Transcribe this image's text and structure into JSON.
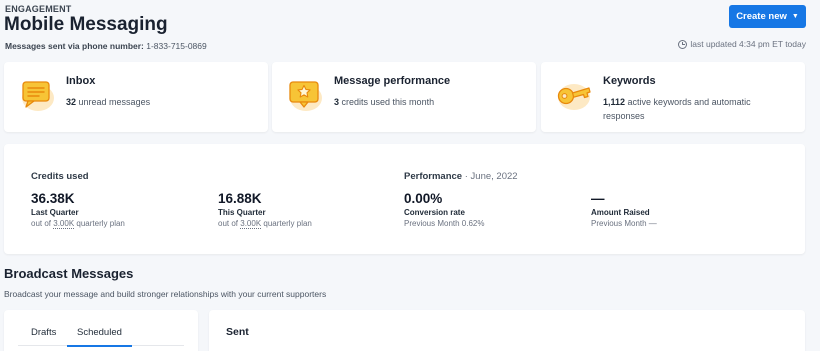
{
  "header": {
    "eyebrow": "ENGAGEMENT",
    "title": "Mobile Messaging",
    "phone_label": "Messages sent via phone number:",
    "phone_number": "1-833-715-0869",
    "create_label": "Create new",
    "updated_text": "last updated 4:34 pm ET today"
  },
  "cards": [
    {
      "title": "Inbox",
      "value": "32",
      "text": "unread messages",
      "icon": "chat-bubble-icon"
    },
    {
      "title": "Message performance",
      "value": "3",
      "text": "credits used this month",
      "icon": "star-message-icon"
    },
    {
      "title": "Keywords",
      "value": "1,112",
      "text": "active keywords and automatic responses",
      "icon": "key-icon"
    }
  ],
  "credits": {
    "heading": "Credits used",
    "items": [
      {
        "value": "36.38K",
        "label": "Last Quarter",
        "sub_pre": "out of",
        "sub_plan": "3.00K",
        "sub_post": "quarterly plan"
      },
      {
        "value": "16.88K",
        "label": "This Quarter",
        "sub_pre": "out of",
        "sub_plan": "3.00K",
        "sub_post": "quarterly plan"
      }
    ]
  },
  "performance": {
    "heading": "Performance",
    "period": "· June, 2022",
    "items": [
      {
        "value": "0.00%",
        "label": "Conversion rate",
        "sub": "Previous Month 0.62%"
      },
      {
        "value": "—",
        "label": "Amount Raised",
        "sub": "Previous Month —"
      }
    ]
  },
  "broadcast": {
    "title": "Broadcast Messages",
    "subtitle": "Broadcast your message and build stronger relationships with your current supporters",
    "tabs": [
      "Drafts",
      "Scheduled"
    ],
    "active_tab": "Scheduled",
    "sent_title": "Sent"
  },
  "colors": {
    "accent": "#1677e5",
    "icon_yellow": "#f7c436",
    "icon_orange": "#f5a524"
  }
}
